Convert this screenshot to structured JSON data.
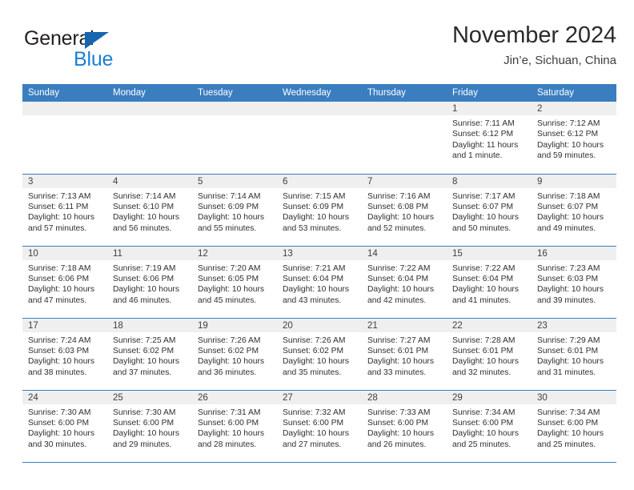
{
  "brand": {
    "name_top": "General",
    "name_bottom": "Blue",
    "triangle_color": "#1565b0",
    "blue_text_color": "#1b7fd4"
  },
  "header": {
    "title": "November 2024",
    "subtitle": "Jin’e, Sichuan, China",
    "accent_color": "#3a7ec0"
  },
  "weekdays": [
    "Sunday",
    "Monday",
    "Tuesday",
    "Wednesday",
    "Thursday",
    "Friday",
    "Saturday"
  ],
  "labels": {
    "sunrise": "Sunrise:",
    "sunset": "Sunset:",
    "daylight": "Daylight:"
  },
  "weeks": [
    [
      {
        "day": "",
        "empty": true
      },
      {
        "day": "",
        "empty": true
      },
      {
        "day": "",
        "empty": true
      },
      {
        "day": "",
        "empty": true
      },
      {
        "day": "",
        "empty": true
      },
      {
        "day": "1",
        "sunrise": "Sunrise: 7:11 AM",
        "sunset": "Sunset: 6:12 PM",
        "daylight1": "Daylight: 11 hours",
        "daylight2": "and 1 minute."
      },
      {
        "day": "2",
        "sunrise": "Sunrise: 7:12 AM",
        "sunset": "Sunset: 6:12 PM",
        "daylight1": "Daylight: 10 hours",
        "daylight2": "and 59 minutes."
      }
    ],
    [
      {
        "day": "3",
        "sunrise": "Sunrise: 7:13 AM",
        "sunset": "Sunset: 6:11 PM",
        "daylight1": "Daylight: 10 hours",
        "daylight2": "and 57 minutes."
      },
      {
        "day": "4",
        "sunrise": "Sunrise: 7:14 AM",
        "sunset": "Sunset: 6:10 PM",
        "daylight1": "Daylight: 10 hours",
        "daylight2": "and 56 minutes."
      },
      {
        "day": "5",
        "sunrise": "Sunrise: 7:14 AM",
        "sunset": "Sunset: 6:09 PM",
        "daylight1": "Daylight: 10 hours",
        "daylight2": "and 55 minutes."
      },
      {
        "day": "6",
        "sunrise": "Sunrise: 7:15 AM",
        "sunset": "Sunset: 6:09 PM",
        "daylight1": "Daylight: 10 hours",
        "daylight2": "and 53 minutes."
      },
      {
        "day": "7",
        "sunrise": "Sunrise: 7:16 AM",
        "sunset": "Sunset: 6:08 PM",
        "daylight1": "Daylight: 10 hours",
        "daylight2": "and 52 minutes."
      },
      {
        "day": "8",
        "sunrise": "Sunrise: 7:17 AM",
        "sunset": "Sunset: 6:07 PM",
        "daylight1": "Daylight: 10 hours",
        "daylight2": "and 50 minutes."
      },
      {
        "day": "9",
        "sunrise": "Sunrise: 7:18 AM",
        "sunset": "Sunset: 6:07 PM",
        "daylight1": "Daylight: 10 hours",
        "daylight2": "and 49 minutes."
      }
    ],
    [
      {
        "day": "10",
        "sunrise": "Sunrise: 7:18 AM",
        "sunset": "Sunset: 6:06 PM",
        "daylight1": "Daylight: 10 hours",
        "daylight2": "and 47 minutes."
      },
      {
        "day": "11",
        "sunrise": "Sunrise: 7:19 AM",
        "sunset": "Sunset: 6:06 PM",
        "daylight1": "Daylight: 10 hours",
        "daylight2": "and 46 minutes."
      },
      {
        "day": "12",
        "sunrise": "Sunrise: 7:20 AM",
        "sunset": "Sunset: 6:05 PM",
        "daylight1": "Daylight: 10 hours",
        "daylight2": "and 45 minutes."
      },
      {
        "day": "13",
        "sunrise": "Sunrise: 7:21 AM",
        "sunset": "Sunset: 6:04 PM",
        "daylight1": "Daylight: 10 hours",
        "daylight2": "and 43 minutes."
      },
      {
        "day": "14",
        "sunrise": "Sunrise: 7:22 AM",
        "sunset": "Sunset: 6:04 PM",
        "daylight1": "Daylight: 10 hours",
        "daylight2": "and 42 minutes."
      },
      {
        "day": "15",
        "sunrise": "Sunrise: 7:22 AM",
        "sunset": "Sunset: 6:04 PM",
        "daylight1": "Daylight: 10 hours",
        "daylight2": "and 41 minutes."
      },
      {
        "day": "16",
        "sunrise": "Sunrise: 7:23 AM",
        "sunset": "Sunset: 6:03 PM",
        "daylight1": "Daylight: 10 hours",
        "daylight2": "and 39 minutes."
      }
    ],
    [
      {
        "day": "17",
        "sunrise": "Sunrise: 7:24 AM",
        "sunset": "Sunset: 6:03 PM",
        "daylight1": "Daylight: 10 hours",
        "daylight2": "and 38 minutes."
      },
      {
        "day": "18",
        "sunrise": "Sunrise: 7:25 AM",
        "sunset": "Sunset: 6:02 PM",
        "daylight1": "Daylight: 10 hours",
        "daylight2": "and 37 minutes."
      },
      {
        "day": "19",
        "sunrise": "Sunrise: 7:26 AM",
        "sunset": "Sunset: 6:02 PM",
        "daylight1": "Daylight: 10 hours",
        "daylight2": "and 36 minutes."
      },
      {
        "day": "20",
        "sunrise": "Sunrise: 7:26 AM",
        "sunset": "Sunset: 6:02 PM",
        "daylight1": "Daylight: 10 hours",
        "daylight2": "and 35 minutes."
      },
      {
        "day": "21",
        "sunrise": "Sunrise: 7:27 AM",
        "sunset": "Sunset: 6:01 PM",
        "daylight1": "Daylight: 10 hours",
        "daylight2": "and 33 minutes."
      },
      {
        "day": "22",
        "sunrise": "Sunrise: 7:28 AM",
        "sunset": "Sunset: 6:01 PM",
        "daylight1": "Daylight: 10 hours",
        "daylight2": "and 32 minutes."
      },
      {
        "day": "23",
        "sunrise": "Sunrise: 7:29 AM",
        "sunset": "Sunset: 6:01 PM",
        "daylight1": "Daylight: 10 hours",
        "daylight2": "and 31 minutes."
      }
    ],
    [
      {
        "day": "24",
        "sunrise": "Sunrise: 7:30 AM",
        "sunset": "Sunset: 6:00 PM",
        "daylight1": "Daylight: 10 hours",
        "daylight2": "and 30 minutes."
      },
      {
        "day": "25",
        "sunrise": "Sunrise: 7:30 AM",
        "sunset": "Sunset: 6:00 PM",
        "daylight1": "Daylight: 10 hours",
        "daylight2": "and 29 minutes."
      },
      {
        "day": "26",
        "sunrise": "Sunrise: 7:31 AM",
        "sunset": "Sunset: 6:00 PM",
        "daylight1": "Daylight: 10 hours",
        "daylight2": "and 28 minutes."
      },
      {
        "day": "27",
        "sunrise": "Sunrise: 7:32 AM",
        "sunset": "Sunset: 6:00 PM",
        "daylight1": "Daylight: 10 hours",
        "daylight2": "and 27 minutes."
      },
      {
        "day": "28",
        "sunrise": "Sunrise: 7:33 AM",
        "sunset": "Sunset: 6:00 PM",
        "daylight1": "Daylight: 10 hours",
        "daylight2": "and 26 minutes."
      },
      {
        "day": "29",
        "sunrise": "Sunrise: 7:34 AM",
        "sunset": "Sunset: 6:00 PM",
        "daylight1": "Daylight: 10 hours",
        "daylight2": "and 25 minutes."
      },
      {
        "day": "30",
        "sunrise": "Sunrise: 7:34 AM",
        "sunset": "Sunset: 6:00 PM",
        "daylight1": "Daylight: 10 hours",
        "daylight2": "and 25 minutes."
      }
    ]
  ]
}
